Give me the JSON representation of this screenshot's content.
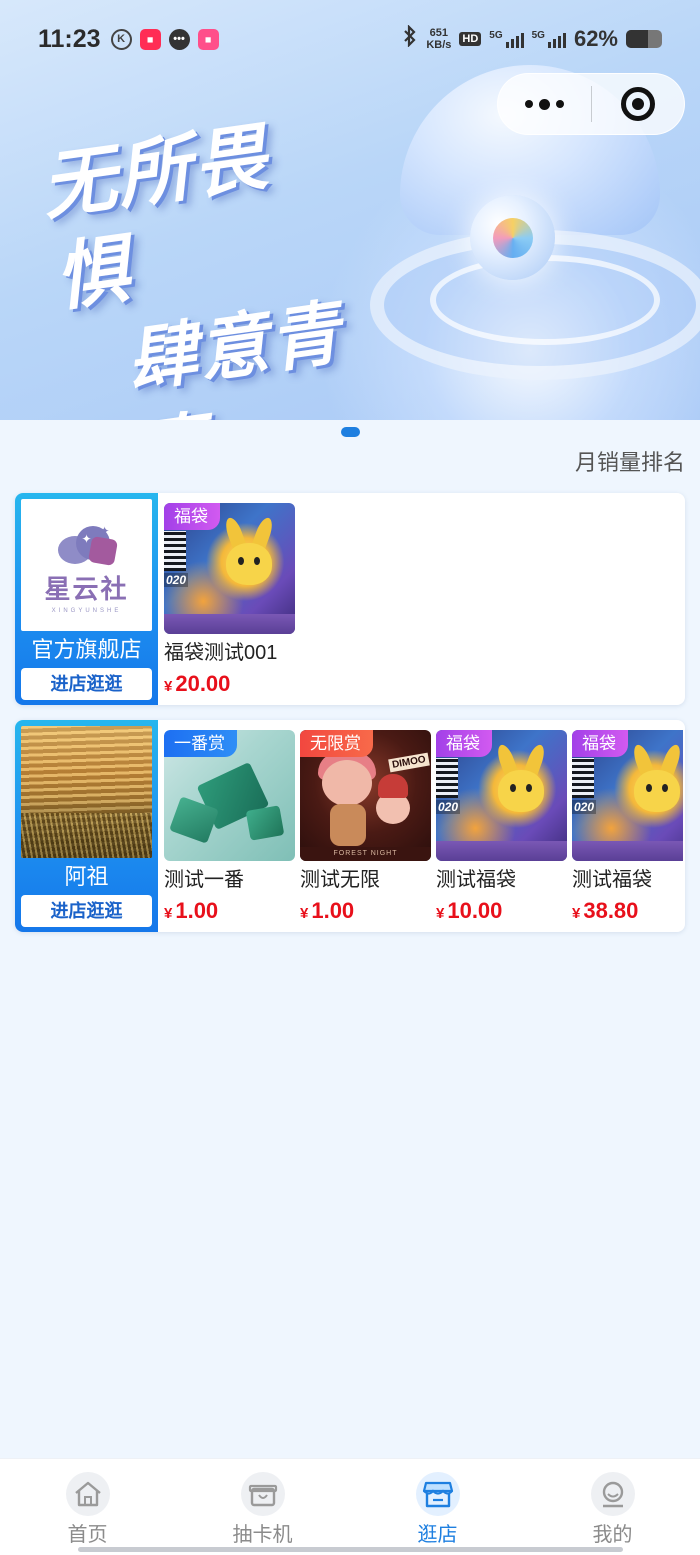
{
  "status_bar": {
    "time": "11:23",
    "speed_value": "651",
    "speed_unit": "KB/s",
    "hd_label": "HD",
    "sig1_label": "5G",
    "sig2_label": "5G",
    "battery_percent": "62%",
    "battery_level": 0.62,
    "icons": [
      "k-icon",
      "app-red-icon",
      "chat-icon",
      "app-pink-icon",
      "bluetooth-icon",
      "signal-icon",
      "battery-icon"
    ]
  },
  "banner": {
    "slogan_line1": "无所畏惧",
    "slogan_line2": "肆意青春",
    "active_slide": 1
  },
  "ranking_label": "月销量排名",
  "shops": [
    {
      "name": "官方旗舰店",
      "logo_text": "星云社",
      "logo_subtext": "XINGYUNSHE",
      "enter_label": "进店逛逛",
      "products": [
        {
          "tag": "福袋",
          "name": "福袋测试001",
          "currency": "¥",
          "price": "20.00",
          "card_number": "020"
        }
      ]
    },
    {
      "name": "阿祖",
      "enter_label": "进店逛逛",
      "products": [
        {
          "tag": "一番赏",
          "name": "测试一番",
          "currency": "¥",
          "price": "1.00"
        },
        {
          "tag": "无限赏",
          "name": "测试无限",
          "currency": "¥",
          "price": "1.00",
          "brand": "DIMOO",
          "strip": "FOREST NIGHT"
        },
        {
          "tag": "福袋",
          "name": "测试福袋",
          "currency": "¥",
          "price": "10.00",
          "card_number": "020"
        },
        {
          "tag": "福袋",
          "name": "测试福袋",
          "currency": "¥",
          "price": "38.80",
          "card_number": "020"
        }
      ]
    }
  ],
  "tabbar": {
    "tabs": [
      {
        "label": "首页",
        "icon": "home-icon"
      },
      {
        "label": "抽卡机",
        "icon": "gift-box-icon"
      },
      {
        "label": "逛店",
        "icon": "store-icon"
      },
      {
        "label": "我的",
        "icon": "user-icon"
      }
    ],
    "active": 2
  },
  "colors": {
    "accent": "#1e7fe0",
    "price": "#e8101b",
    "tag_fudai": "#a240e8",
    "tag_yifan": "#1d6ff2",
    "tag_wuxian": "#f2473f"
  }
}
